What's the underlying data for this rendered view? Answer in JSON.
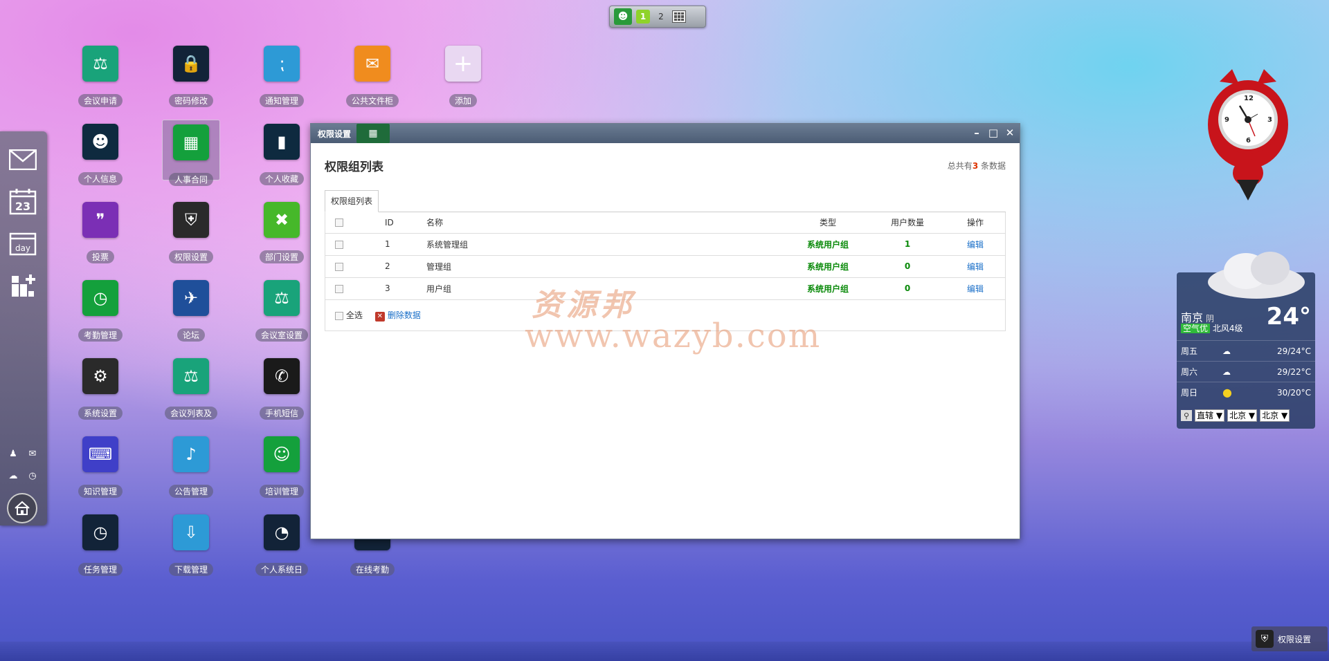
{
  "top_dock": {
    "pages": [
      "1",
      "2"
    ]
  },
  "desktop_icons": [
    {
      "label": "会议申请",
      "color": "#19a37a",
      "glyph": "plug-icon"
    },
    {
      "label": "密码修改",
      "color": "#122338",
      "glyph": "lock-icon"
    },
    {
      "label": "通知管理",
      "color": "#2d9ad6",
      "glyph": "broadcast-icon"
    },
    {
      "label": "公共文件柜",
      "color": "#f08c1e",
      "glyph": "mail-icon"
    },
    {
      "label": "添加",
      "color": "#e9d8f2",
      "glyph": "plus-icon"
    },
    {
      "label": "个人信息",
      "color": "#0e2a3f",
      "glyph": "person-icon"
    },
    {
      "label": "人事合同",
      "color": "#14a03c",
      "glyph": "cards-icon"
    },
    {
      "label": "个人收藏",
      "color": "#0e2a3f",
      "glyph": "id-card-icon"
    },
    {
      "label": "投票",
      "color": "#7b2fb5",
      "glyph": "chat-icon"
    },
    {
      "label": "权限设置",
      "color": "#2a2a2a",
      "glyph": "shield-icon"
    },
    {
      "label": "部门设置",
      "color": "#46b82a",
      "glyph": "xbox-icon"
    },
    {
      "label": "考勤管理",
      "color": "#14a03c",
      "glyph": "clock-icon"
    },
    {
      "label": "论坛",
      "color": "#1f4f9a",
      "glyph": "forum-icon"
    },
    {
      "label": "会议室设置",
      "color": "#19a37a",
      "glyph": "plug-icon"
    },
    {
      "label": "系统设置",
      "color": "#2a2a2a",
      "glyph": "settings-icon"
    },
    {
      "label": "会议列表及",
      "color": "#19a37a",
      "glyph": "plug-icon"
    },
    {
      "label": "手机短信",
      "color": "#1a1a1a",
      "glyph": "phone-icon"
    },
    {
      "label": "知识管理",
      "color": "#3f3fc8",
      "glyph": "laptop-icon"
    },
    {
      "label": "公告管理",
      "color": "#2d9ad6",
      "glyph": "speaker-icon"
    },
    {
      "label": "培训管理",
      "color": "#14a03c",
      "glyph": "group-icon"
    },
    {
      "label": "任务管理",
      "color": "#122338",
      "glyph": "clock-icon"
    },
    {
      "label": "下载管理",
      "color": "#2d9ad6",
      "glyph": "download-icon"
    },
    {
      "label": "个人系统日",
      "color": "#122338",
      "glyph": "pie-icon"
    },
    {
      "label": "在线考勤",
      "color": "#122338",
      "glyph": "check-icon"
    }
  ],
  "left_bar": {
    "calendar_day": "23",
    "day_label": "day"
  },
  "window": {
    "title": "权限设置",
    "pane_title": "权限组列表",
    "count_prefix": "总共有",
    "count_value": "3",
    "count_suffix": " 条数据",
    "tab_label": "权限组列表",
    "columns": [
      "ID",
      "名称",
      "类型",
      "用户数量",
      "操作"
    ],
    "rows": [
      {
        "id": "1",
        "name": "系统管理组",
        "type": "系统用户组",
        "count": "1",
        "action": "编辑"
      },
      {
        "id": "2",
        "name": "管理组",
        "type": "系统用户组",
        "count": "0",
        "action": "编辑"
      },
      {
        "id": "3",
        "name": "用户组",
        "type": "系统用户组",
        "count": "0",
        "action": "编辑"
      }
    ],
    "select_all_label": "全选",
    "delete_label": "删除数据"
  },
  "watermark": {
    "line1": "资源邦",
    "line2": "www.wazyb.com"
  },
  "clock": {
    "numbers": [
      "12",
      "3",
      "6",
      "9"
    ]
  },
  "weather": {
    "city": "南京",
    "condition": "阴",
    "temp": "24°",
    "air_quality": "空气优",
    "wind": "北风4级",
    "forecast": [
      {
        "day": "周五",
        "icon": "cloud-icon",
        "temp": "29/24°C"
      },
      {
        "day": "周六",
        "icon": "rain-cloud-icon",
        "temp": "29/22°C"
      },
      {
        "day": "周日",
        "icon": "sun-icon",
        "temp": "30/20°C"
      }
    ],
    "selects": [
      "直辖",
      "北京",
      "北京"
    ]
  },
  "tray": {
    "label": "权限设置"
  }
}
